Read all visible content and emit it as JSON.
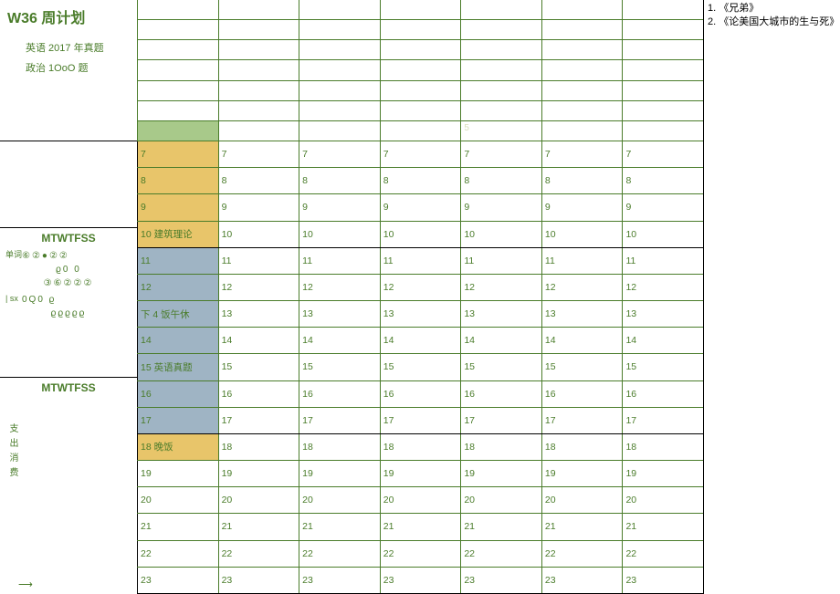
{
  "title": {
    "week": "W36",
    "label": "周计划",
    "sub1": "英语 2017 年真题",
    "sub2": "政治 1OoO 题"
  },
  "notes": {
    "n1": "1. 《兄弟》",
    "n2": "2. 《论美国大城市的生与死》"
  },
  "topFaint": "5",
  "tracker1": {
    "heading": "MTWTFSS",
    "lbl_word": "单词",
    "row1": "⑥②●②②",
    "row2": "ϱ0     0",
    "row3": "③⑥②②②",
    "lbl_sx": "| sx",
    "row4": "0Q0     ϱ",
    "row5": "ϱϱϱϱϱ"
  },
  "tracker2": {
    "heading": "MTWTFSS",
    "side": "支出消费",
    "arrow": "⟶"
  },
  "schedule": {
    "col1": {
      "r7": "7",
      "r8": "8",
      "r9": "9",
      "r10": "10 建筑理论",
      "r11": "11",
      "r12": "12",
      "r13": "下 4 饭午休",
      "r14": "14",
      "r15": "15 英语真题",
      "r16": "16",
      "r17": "17",
      "r18": "18 晚饭",
      "r19": "19",
      "r20": "20",
      "r21": "21",
      "r22": "22",
      "r23": "23"
    },
    "nums": {
      "r7": "7",
      "r8": "8",
      "r9": "9",
      "r10": "10",
      "r11": "11",
      "r12": "12",
      "r13": "13",
      "r14": "14",
      "r15": "15",
      "r16": "16",
      "r17": "17",
      "r18": "18",
      "r19": "19",
      "r20": "20",
      "r21": "21",
      "r22": "22",
      "r23": "23"
    }
  }
}
